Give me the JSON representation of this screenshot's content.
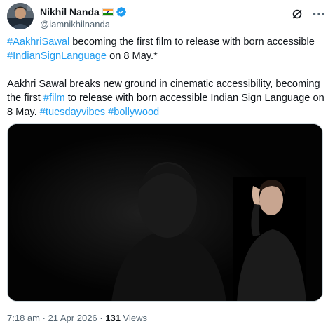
{
  "author": {
    "display_name": "Nikhil Nanda",
    "handle": "@iamnikhilnanda",
    "flag_icon": "india-flag-icon",
    "verified_icon": "verified-badge-icon",
    "verified_color": "#1d9bf0"
  },
  "header_actions": {
    "grok_icon": "grok-icon",
    "more_icon": "more-options-icon"
  },
  "tweet": {
    "line1_tag1": "#AakhriSawal",
    "line1_text1": " becoming the first film to release with born accessible ",
    "line1_tag2": "#IndianSignLanguage",
    "line1_text2": " on 8 May.*",
    "line2_text1": "Aakhri Sawal breaks new ground in cinematic accessibility, becoming the first ",
    "line2_tag1": "#film",
    "line2_text2": " to release with born accessible Indian Sign Language on 8 May. ",
    "line2_tag2": "#tuesdayvibes",
    "line2_sep": " ",
    "line2_tag3": "#bollywood"
  },
  "meta": {
    "time": "7:18 am",
    "sep": " · ",
    "date": "21 Apr 2026",
    "views_count": "131",
    "views_label": " Views"
  },
  "colors": {
    "link": "#1d9bf0",
    "text": "#0f1419",
    "secondary": "#536471",
    "media_bg": "#030303"
  }
}
